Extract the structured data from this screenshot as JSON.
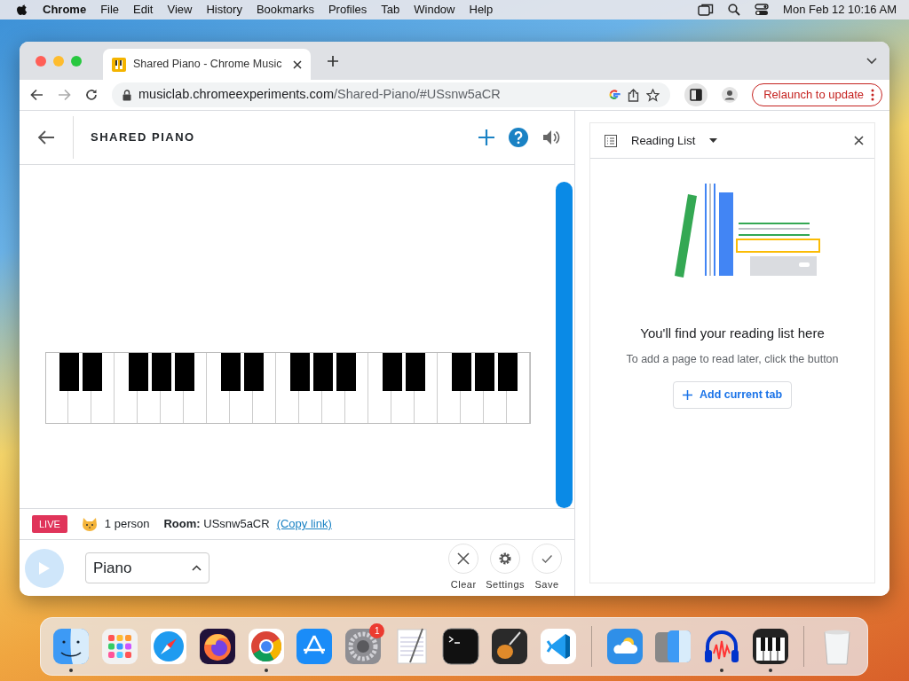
{
  "menu_bar": {
    "app_name": "Chrome",
    "menus": [
      "File",
      "Edit",
      "View",
      "History",
      "Bookmarks",
      "Profiles",
      "Tab",
      "Window",
      "Help"
    ],
    "clock": "Mon Feb 12  10:16 AM"
  },
  "browser": {
    "tab_title": "Shared Piano - Chrome Music",
    "url_host": "musiclab.chromeexperiments.com",
    "url_path": "/Shared-Piano/#USsnw5aCR",
    "relaunch": "Relaunch to update"
  },
  "app": {
    "title": "SHARED PIANO",
    "live": "LIVE",
    "people": "1 person",
    "room_label": "Room:",
    "room_id": "USsnw5aCR",
    "copy_link": "(Copy link)",
    "instrument": "Piano",
    "actions": [
      {
        "kind": "clear",
        "label": "Clear"
      },
      {
        "kind": "settings",
        "label": "Settings"
      },
      {
        "kind": "save",
        "label": "Save"
      }
    ]
  },
  "reading_list": {
    "title": "Reading List",
    "heading": "You'll find your reading list here",
    "text": "To add a page to read later, click the button",
    "button": "Add current tab"
  },
  "dock": [
    {
      "kind": "finder",
      "running": true
    },
    {
      "kind": "launchpad",
      "running": false
    },
    {
      "kind": "safari",
      "running": false
    },
    {
      "kind": "firefox",
      "running": false
    },
    {
      "kind": "chrome",
      "running": true
    },
    {
      "kind": "appstore",
      "running": false
    },
    {
      "kind": "settings",
      "running": false,
      "badge": "1"
    },
    {
      "kind": "textedit",
      "running": false
    },
    {
      "kind": "terminal",
      "running": false
    },
    {
      "kind": "garageband",
      "running": false
    },
    {
      "kind": "vscode",
      "running": false
    },
    {
      "kind": "separator"
    },
    {
      "kind": "weather",
      "running": false
    },
    {
      "kind": "migration",
      "running": false
    },
    {
      "kind": "audacity",
      "running": true
    },
    {
      "kind": "piano",
      "running": true
    },
    {
      "kind": "separator"
    },
    {
      "kind": "trash",
      "running": false
    }
  ]
}
